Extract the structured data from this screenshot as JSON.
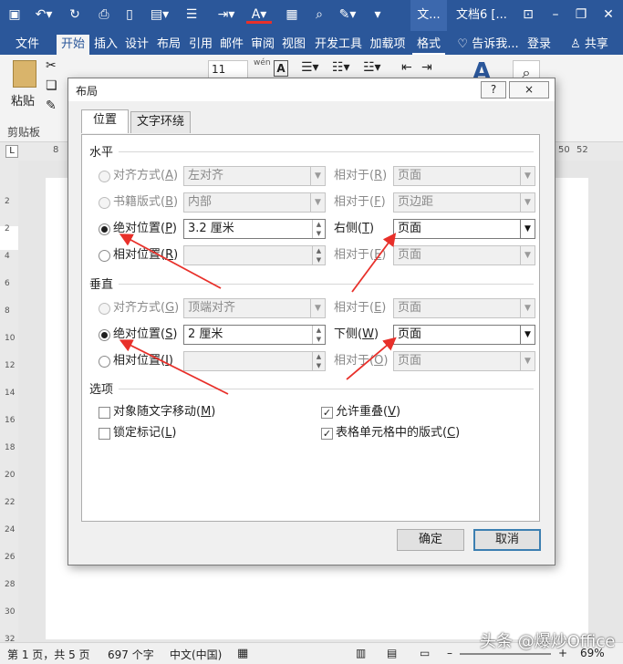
{
  "titlebar": {
    "doc_tab": "文...",
    "doc_name": "文档6 [...",
    "qa_icons": [
      "save-icon",
      "undo-icon",
      "redo-icon",
      "print-preview-icon",
      "new-doc-icon",
      "paste-icon",
      "align-icon",
      "paragraph-icon",
      "font-color-icon",
      "table-icon",
      "search-icon",
      "highlight-icon",
      "customize-icon"
    ]
  },
  "ribbon_tabs": [
    "文件",
    "开始",
    "插入",
    "设计",
    "布局",
    "引用",
    "邮件",
    "审阅",
    "视图",
    "开发工具",
    "加载项",
    "格式"
  ],
  "ribbon_right": {
    "tell": "告诉我...",
    "login": "登录",
    "share": "共享"
  },
  "ribbon": {
    "paste": "粘贴",
    "clipboard": "剪贴板",
    "font_size": "11",
    "wen": "wén",
    "wen_char": "文"
  },
  "ruler": {
    "left_num": "8",
    "right_nums": [
      "50",
      "52"
    ]
  },
  "vruler": [
    "2",
    "2",
    "4",
    "6",
    "8",
    "10",
    "12",
    "14",
    "16",
    "18",
    "20",
    "22",
    "24",
    "26",
    "28",
    "30",
    "32"
  ],
  "status": {
    "page": "第 1 页，共 5 页",
    "words": "697 个字",
    "lang": "中文(中国)",
    "zoom": "69%",
    "watermark": "头条 @爆炒Office"
  },
  "dialog": {
    "title": "布局",
    "help": "?",
    "close": "×",
    "tabs": [
      "位置",
      "文字环绕"
    ],
    "horizontal": {
      "title": "水平",
      "rows": [
        {
          "label": "对齐方式(A)",
          "key": "A",
          "value": "左对齐",
          "rel_label": "相对于(R)",
          "rel_value": "页面",
          "selected": false
        },
        {
          "label": "书籍版式(B)",
          "key": "B",
          "value": "内部",
          "rel_label": "相对于(F)",
          "rel_value": "页边距",
          "selected": false
        },
        {
          "label": "绝对位置(P)",
          "key": "P",
          "value": "3.2 厘米",
          "rel_label": "右侧(T)",
          "rel_value": "页面",
          "selected": true
        },
        {
          "label": "相对位置(R)",
          "key": "R",
          "value": "",
          "rel_label": "相对于(E)",
          "rel_value": "页面",
          "selected": false
        }
      ]
    },
    "vertical": {
      "title": "垂直",
      "rows": [
        {
          "label": "对齐方式(G)",
          "key": "G",
          "value": "顶端对齐",
          "rel_label": "相对于(E)",
          "rel_value": "页面",
          "selected": false
        },
        {
          "label": "绝对位置(S)",
          "key": "S",
          "value": "2 厘米",
          "rel_label": "下侧(W)",
          "rel_value": "页面",
          "selected": true
        },
        {
          "label": "相对位置(I)",
          "key": "I",
          "value": "",
          "rel_label": "相对于(O)",
          "rel_value": "页面",
          "selected": false
        }
      ]
    },
    "options": {
      "title": "选项",
      "items": [
        {
          "label": "对象随文字移动(M)",
          "checked": false
        },
        {
          "label": "锁定标记(L)",
          "checked": false
        },
        {
          "label": "允许重叠(V)",
          "checked": true
        },
        {
          "label": "表格单元格中的版式(C)",
          "checked": true
        }
      ]
    },
    "ok": "确定",
    "cancel": "取消"
  },
  "colors": {
    "accent": "#2b579a",
    "annotation": "#e8302a"
  }
}
